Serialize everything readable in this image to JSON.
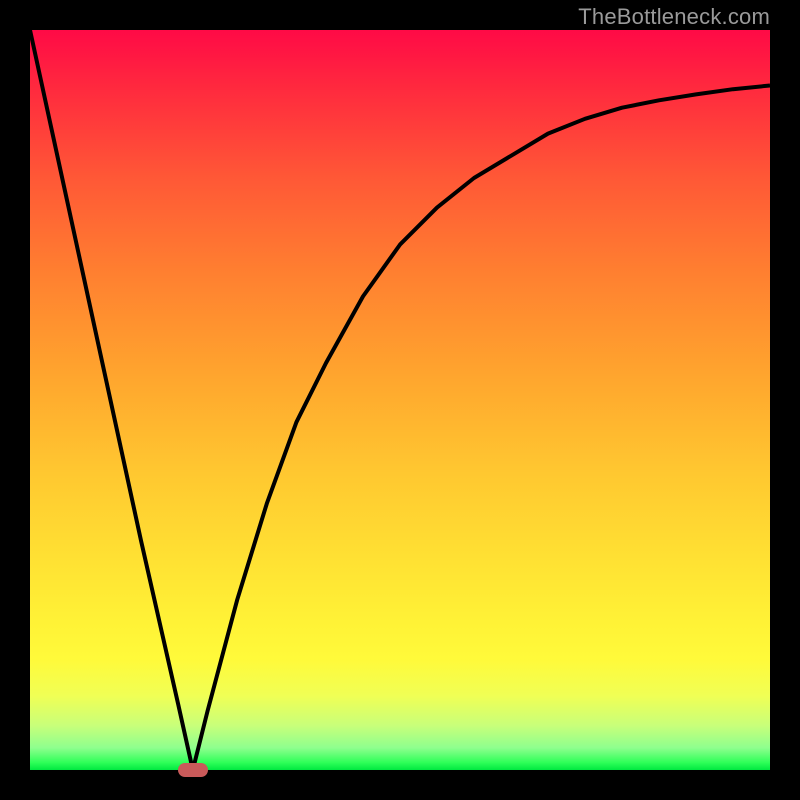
{
  "watermark": "TheBottleneck.com",
  "colors": {
    "background": "#000000",
    "gradient_top": "#ff0a46",
    "gradient_bottom": "#00e840",
    "curve": "#000000",
    "marker": "#c95a5a",
    "watermark_text": "#9a9a9a"
  },
  "chart_data": {
    "type": "line",
    "title": "",
    "xlabel": "",
    "ylabel": "",
    "xlim": [
      0,
      100
    ],
    "ylim": [
      0,
      100
    ],
    "grid": false,
    "legend": false,
    "annotations": [
      {
        "text": "TheBottleneck.com",
        "position": "top-right"
      }
    ],
    "marker": {
      "x": 22,
      "y": 0
    },
    "series": [
      {
        "name": "curve",
        "x": [
          0,
          5,
          10,
          15,
          20,
          22,
          24,
          28,
          32,
          36,
          40,
          45,
          50,
          55,
          60,
          65,
          70,
          75,
          80,
          85,
          90,
          95,
          100
        ],
        "y": [
          100,
          77,
          54,
          31,
          9,
          0,
          8,
          23,
          36,
          47,
          55,
          64,
          71,
          76,
          80,
          83,
          86,
          88,
          89.5,
          90.5,
          91.3,
          92,
          92.5
        ]
      }
    ]
  }
}
